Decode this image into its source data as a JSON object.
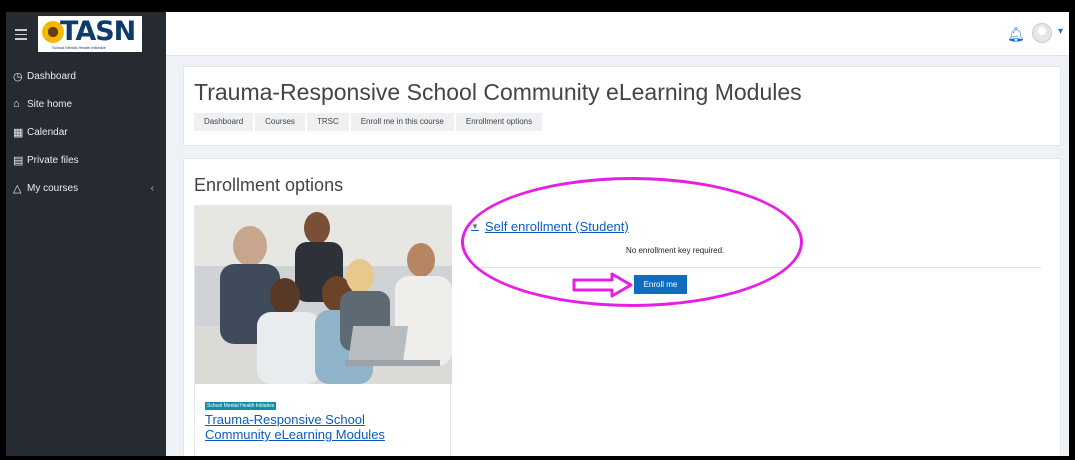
{
  "navbar": {
    "logo_text": "TASN",
    "logo_tagline": "School Mental Health Initiative",
    "bell_icon": "bell-icon",
    "avatar_icon": "user-avatar-icon"
  },
  "drawer": {
    "items": [
      {
        "label": "Dashboard",
        "icon": "dashboard-icon"
      },
      {
        "label": "Site home",
        "icon": "home-icon"
      },
      {
        "label": "Calendar",
        "icon": "calendar-icon"
      },
      {
        "label": "Private files",
        "icon": "files-icon"
      },
      {
        "label": "My courses",
        "icon": "graduation-cap-icon"
      }
    ]
  },
  "header": {
    "title": "Trauma-Responsive School Community eLearning Modules",
    "breadcrumb": [
      "Dashboard",
      "Courses",
      "TRSC",
      "Enroll me in this course",
      "Enrollment options"
    ]
  },
  "main": {
    "section_title": "Enrollment options",
    "course": {
      "category": "School Mental Health Initiative",
      "title": "Trauma-Responsive School Community eLearning Modules"
    },
    "self_enrollment": {
      "heading": "Self enrollment (Student)",
      "note": "No enrollment key required.",
      "button_label": "Enroll me"
    }
  },
  "colors": {
    "accent": "#0f6cbf",
    "annotation": "#e61fe6",
    "drawer_bg": "#262b31"
  }
}
